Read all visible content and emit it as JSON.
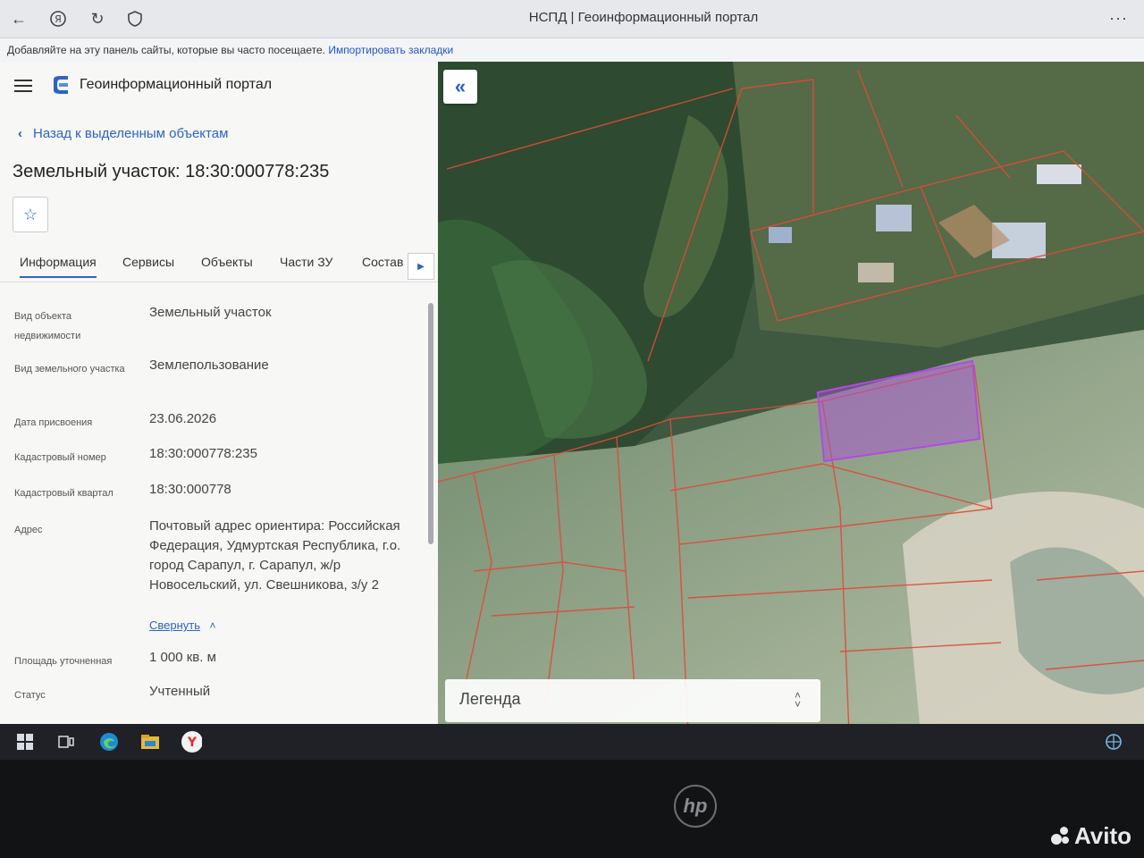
{
  "browser": {
    "window_title": "НСПД | Геоинформационный портал",
    "bookmarks_text": "Добавляйте на эту панель сайты, которые вы часто посещаете.",
    "import_link": "Импортировать закладки",
    "more_label": "···"
  },
  "app": {
    "portal_title": "Геоинформационный портал",
    "back_label": "Назад к выделенным объектам",
    "parcel_title": "Земельный участок: 18:30:000778:235",
    "star_icon": "star-icon"
  },
  "tabs": [
    "Информация",
    "Сервисы",
    "Объекты",
    "Части ЗУ",
    "Состав"
  ],
  "active_tab": "Информация",
  "info": {
    "object_type_label": "Вид объекта недвижимости",
    "object_type_value": "Земельный участок",
    "land_type_label": "Вид земельного участка",
    "land_type_value": "Землепользование",
    "date_label": "Дата присвоения",
    "date_value": "23.06.2026",
    "cadastral_number_label": "Кадастровый номер",
    "cadastral_number_value": "18:30:000778:235",
    "cadastral_quarter_label": "Кадастровый квартал",
    "cadastral_quarter_value": "18:30:000778",
    "address_label": "Адрес",
    "address_value": "Почтовый адрес ориентира: Российская Федерация, Удмуртская Республика, г.о. город Сарапул, г. Сарапул, ж/р Новосельский, ул. Свешникова, з/у 2",
    "collapse_label": "Свернуть",
    "area_label": "Площадь уточненная",
    "area_value": "1 000 кв. м",
    "status_label": "Статус",
    "status_value": "Учтенный"
  },
  "map": {
    "legend_label": "Легенда",
    "highlight_color": "#b04ce0",
    "boundary_color": "#e04a3a"
  },
  "watermark": "Avito",
  "laptop_logo": "hp"
}
